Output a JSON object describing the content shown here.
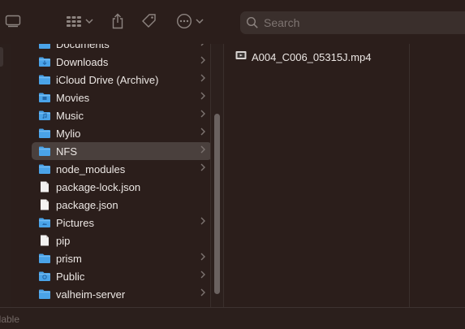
{
  "toolbar": {
    "search_placeholder": "Search"
  },
  "sidebar_column": {
    "items": [
      {
        "label": "Documents",
        "type": "folder",
        "icon": "folder-icon",
        "chevron": true
      },
      {
        "label": "Downloads",
        "type": "folder",
        "icon": "downloads-folder-icon",
        "chevron": true
      },
      {
        "label": "iCloud Drive (Archive)",
        "type": "folder",
        "icon": "folder-icon",
        "chevron": true
      },
      {
        "label": "Movies",
        "type": "folder",
        "icon": "movies-folder-icon",
        "chevron": true
      },
      {
        "label": "Music",
        "type": "folder",
        "icon": "music-folder-icon",
        "chevron": true
      },
      {
        "label": "Mylio",
        "type": "folder",
        "icon": "folder-icon",
        "chevron": true
      },
      {
        "label": "NFS",
        "type": "folder",
        "icon": "folder-icon",
        "chevron": true,
        "selected": true
      },
      {
        "label": "node_modules",
        "type": "folder",
        "icon": "folder-icon",
        "chevron": true
      },
      {
        "label": "package-lock.json",
        "type": "file",
        "icon": "document-icon",
        "chevron": false
      },
      {
        "label": "package.json",
        "type": "file",
        "icon": "document-icon",
        "chevron": false
      },
      {
        "label": "Pictures",
        "type": "folder",
        "icon": "pictures-folder-icon",
        "chevron": true
      },
      {
        "label": "pip",
        "type": "file",
        "icon": "document-icon",
        "chevron": false
      },
      {
        "label": "prism",
        "type": "folder",
        "icon": "folder-icon",
        "chevron": true
      },
      {
        "label": "Public",
        "type": "folder",
        "icon": "public-folder-icon",
        "chevron": true
      },
      {
        "label": "valheim-server",
        "type": "folder",
        "icon": "folder-icon",
        "chevron": true
      }
    ]
  },
  "preview_column": {
    "file": {
      "label": "A004_C006_05315J.mp4",
      "icon": "video-file-icon"
    }
  },
  "status": {
    "text": "ilable"
  },
  "colors": {
    "folder": "#4aa3e8",
    "selected_row": "#4a403d",
    "background": "#2b1e1b"
  }
}
